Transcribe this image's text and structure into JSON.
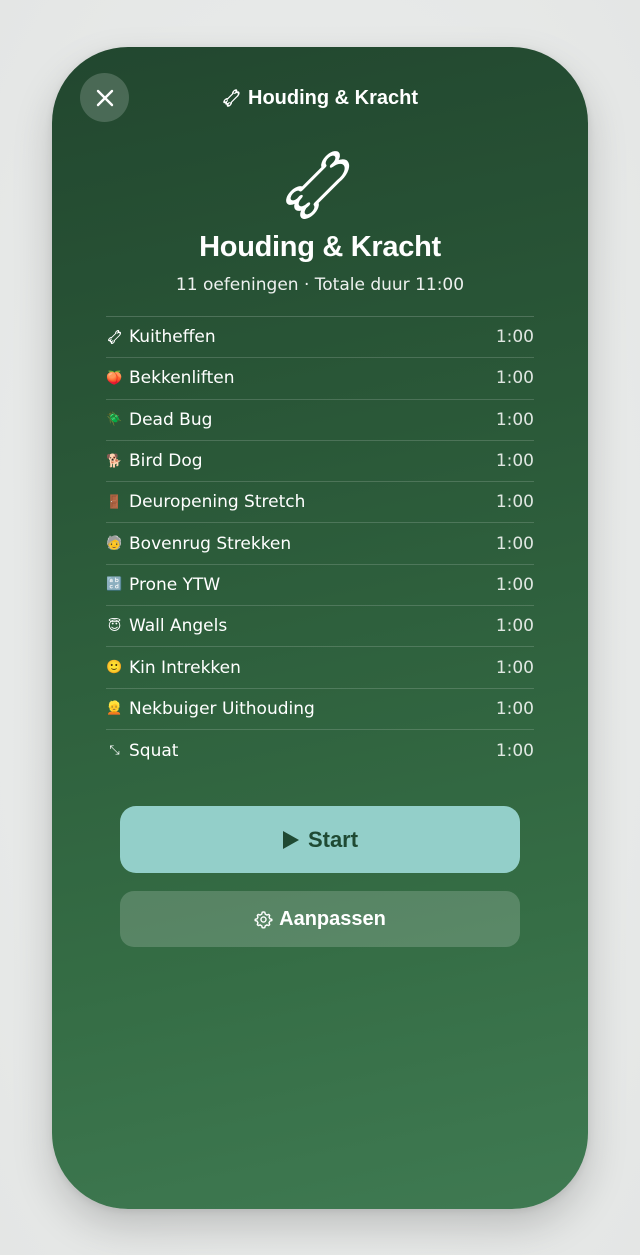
{
  "header": {
    "title": "Houding & Kracht",
    "icon": "bone-icon",
    "close_icon": "close-icon"
  },
  "hero": {
    "icon": "bone-icon",
    "title": "Houding & Kracht",
    "subtitle": "11 oefeningen · Totale duur 11:00"
  },
  "exercises": [
    {
      "icon": "bone-icon",
      "glyph": "",
      "name": "Kuitheffen",
      "duration": "1:00"
    },
    {
      "icon": "peach-icon",
      "glyph": "🍑",
      "name": "Bekkenliften",
      "duration": "1:00"
    },
    {
      "icon": "bug-icon",
      "glyph": "🪲",
      "name": "Dead Bug",
      "duration": "1:00"
    },
    {
      "icon": "dog-icon",
      "glyph": "🐕",
      "name": "Bird Dog",
      "duration": "1:00"
    },
    {
      "icon": "door-icon",
      "glyph": "🚪",
      "name": "Deuropening Stretch",
      "duration": "1:00"
    },
    {
      "icon": "person-icon",
      "glyph": "🧓",
      "name": "Bovenrug Strekken",
      "duration": "1:00"
    },
    {
      "icon": "abcd-icon",
      "glyph": "🔡",
      "name": "Prone YTW",
      "duration": "1:00"
    },
    {
      "icon": "angel-icon",
      "glyph": "😇",
      "name": "Wall Angels",
      "duration": "1:00"
    },
    {
      "icon": "smile-icon",
      "glyph": "🙂",
      "name": "Kin Intrekken",
      "duration": "1:00"
    },
    {
      "icon": "person-icon",
      "glyph": "👱",
      "name": "Nekbuiger Uithouding",
      "duration": "1:00"
    },
    {
      "icon": "resize-arrow-icon",
      "glyph": "⤡",
      "name": "Squat",
      "duration": "1:00"
    }
  ],
  "actions": {
    "start_label": "Start",
    "start_icon": "play-icon",
    "customize_label": "Aanpassen",
    "customize_icon": "gear-icon"
  },
  "colors": {
    "background_top": "#22472f",
    "background_bottom": "#3f7a52",
    "start_button": "#93cfc9",
    "start_text": "#1f4a33"
  }
}
